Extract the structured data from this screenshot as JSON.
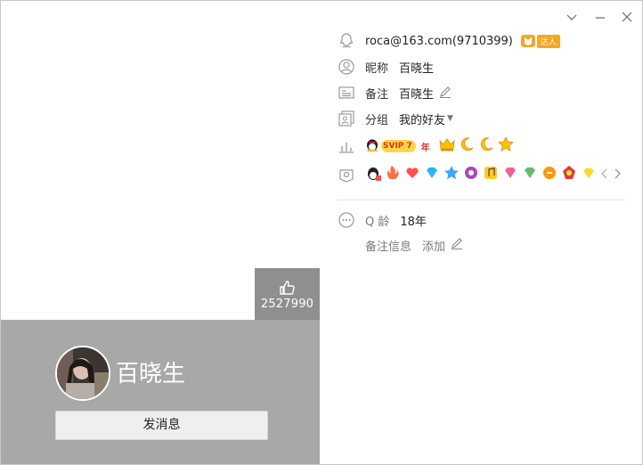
{
  "profile": {
    "email": "roca@163.com(9710399)",
    "nickname_label": "昵称",
    "nickname": "百晓生",
    "remark_label": "备注",
    "remark": "百晓生",
    "group_label": "分组",
    "group": "我的好友",
    "vip_badge": "SVIP 7",
    "vip_years": "年",
    "qage_label": "Q 龄",
    "qage": "18年",
    "remark_info_label": "备注信息",
    "remark_info_action": "添加",
    "daren_badge": "达人"
  },
  "card": {
    "display_name": "百晓生",
    "like_count": "2527990",
    "send_message_label": "发消息"
  },
  "colors": {
    "left_bottom_bg": "#a8a8a8",
    "like_bg": "#8f8f8f",
    "svip_gold": "#ffd64a",
    "svip_red": "#d1361b",
    "daren_orange": "#f5a623"
  },
  "icons": [
    "qq-penguin-icon",
    "person-icon",
    "id-card-icon",
    "group-icon",
    "level-chart-icon",
    "badge-icon",
    "more-dots-icon",
    "thumbs-up-icon",
    "minimize-icon",
    "close-icon",
    "dropdown-icon",
    "pencil-icon"
  ]
}
